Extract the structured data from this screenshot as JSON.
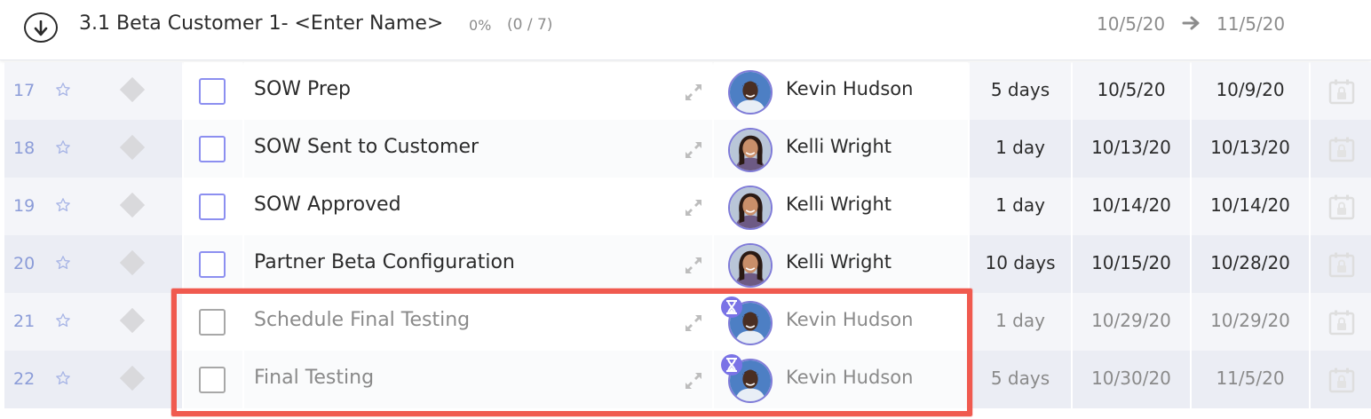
{
  "group": {
    "title": "3.1 Beta Customer 1- <Enter Name>",
    "percent": "0%",
    "count": "(0 / 7)",
    "start": "10/5/20",
    "end": "11/5/20"
  },
  "tasks": [
    {
      "num": "17",
      "name": "SOW Prep",
      "assignee": "Kevin Hudson",
      "duration": "5 days",
      "start": "10/5/20",
      "end": "10/9/20",
      "pending": false
    },
    {
      "num": "18",
      "name": "SOW Sent to Customer",
      "assignee": "Kelli Wright",
      "duration": "1 day",
      "start": "10/13/20",
      "end": "10/13/20",
      "pending": false
    },
    {
      "num": "19",
      "name": "SOW Approved",
      "assignee": "Kelli Wright",
      "duration": "1 day",
      "start": "10/14/20",
      "end": "10/14/20",
      "pending": false
    },
    {
      "num": "20",
      "name": "Partner Beta Configuration",
      "assignee": "Kelli Wright",
      "duration": "10 days",
      "start": "10/15/20",
      "end": "10/28/20",
      "pending": false
    },
    {
      "num": "21",
      "name": "Schedule Final Testing",
      "assignee": "Kevin Hudson",
      "duration": "1 day",
      "start": "10/29/20",
      "end": "10/29/20",
      "pending": true
    },
    {
      "num": "22",
      "name": "Final Testing",
      "assignee": "Kevin Hudson",
      "duration": "5 days",
      "start": "10/30/20",
      "end": "11/5/20",
      "pending": true
    }
  ],
  "icons": {
    "collapse": "arrow-down-circle-icon",
    "star": "star-icon",
    "milestone": "diamond-icon",
    "expand": "expand-arrows-icon",
    "pending": "hourglass-icon",
    "lock": "calendar-lock-icon"
  },
  "colors": {
    "highlight": "#f05a4f",
    "accent": "#7a73e6",
    "row_number": "#8b9cd8"
  }
}
